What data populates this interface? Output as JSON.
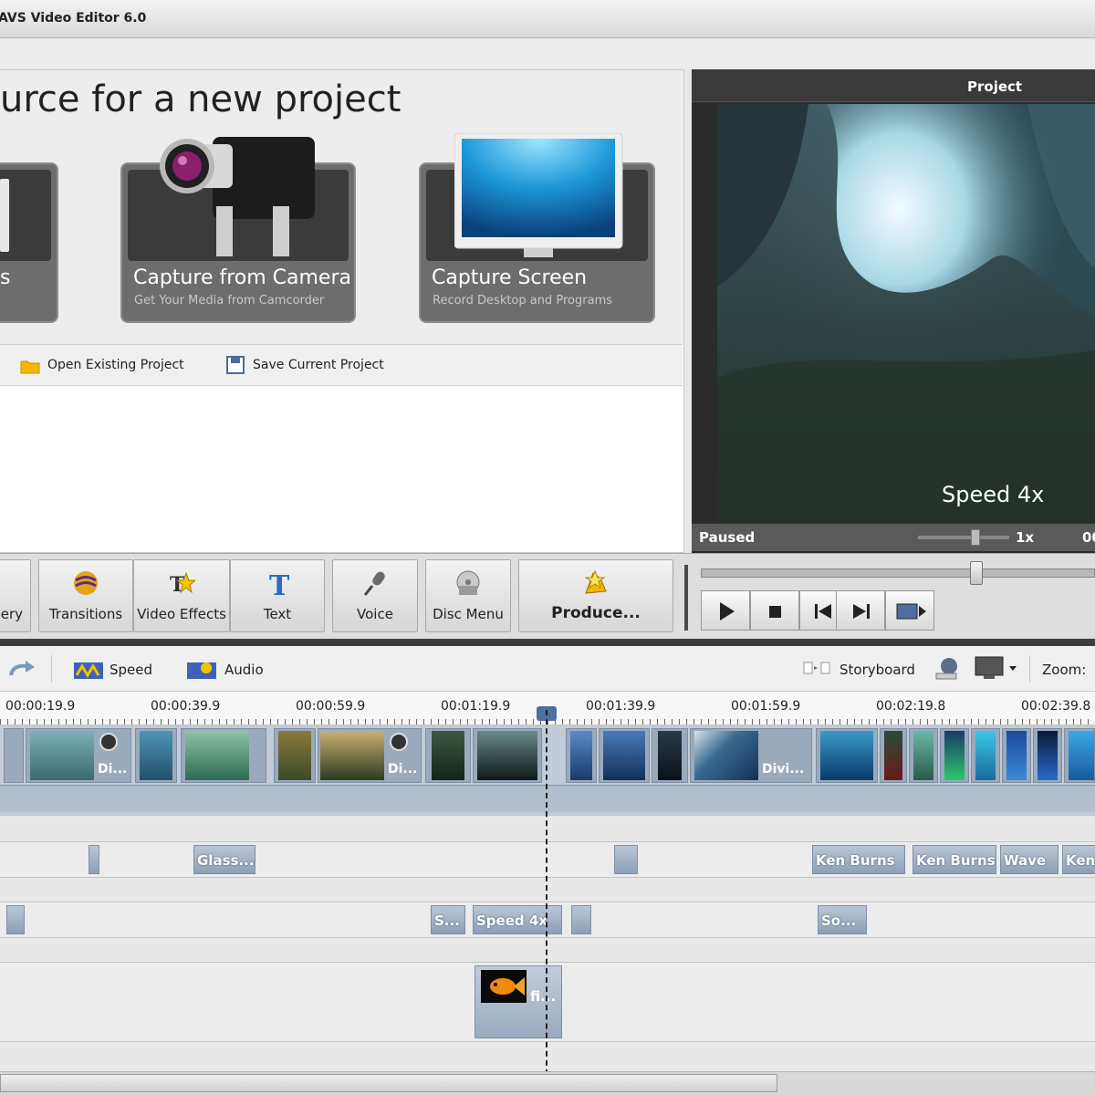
{
  "window": {
    "title": "AVS Video Editor 6.0"
  },
  "start": {
    "headline": "urce for a new project",
    "cards": [
      {
        "title": "Capture from Camera",
        "subtitle": "Get Your Media from Camcorder"
      },
      {
        "title": "Capture Screen",
        "subtitle": "Record Desktop and Programs"
      }
    ],
    "partial_card_label": "s",
    "links": {
      "open": "Open Existing Project",
      "save": "Save Current Project"
    }
  },
  "preview": {
    "header": "Project",
    "overlay_text": "Speed 4x",
    "status": "Paused",
    "speed": "1x",
    "time_partial": "00"
  },
  "toolbar": {
    "partial_label": "ery",
    "buttons": [
      "Transitions",
      "Video Effects",
      "Text",
      "Voice",
      "Disc Menu"
    ],
    "produce": "Produce..."
  },
  "timeline_bar": {
    "speed": "Speed",
    "audio": "Audio",
    "storyboard": "Storyboard",
    "zoom": "Zoom:"
  },
  "ruler_ticks": [
    "00:00:19.9",
    "00:00:39.9",
    "00:00:59.9",
    "00:01:19.9",
    "00:01:39.9",
    "00:01:59.9",
    "00:02:19.8",
    "00:02:39.8"
  ],
  "clip_labels": {
    "di1": "Di...",
    "di2": "Di...",
    "divi": "Divi..."
  },
  "effects_track": {
    "glass": "Glass...",
    "kb1": "Ken Burns",
    "kb2": "Ken Burns",
    "wave": "Wave",
    "ken": "Ken"
  },
  "text_track": {
    "s": "S...",
    "speed": "Speed 4x",
    "so": "So..."
  },
  "overlay_track": {
    "fi": "fi..."
  },
  "colors": {
    "accent_blue": "#4d6fa2",
    "clip_blue": "#9aaabd",
    "toolbar_gray": "#dedede"
  }
}
